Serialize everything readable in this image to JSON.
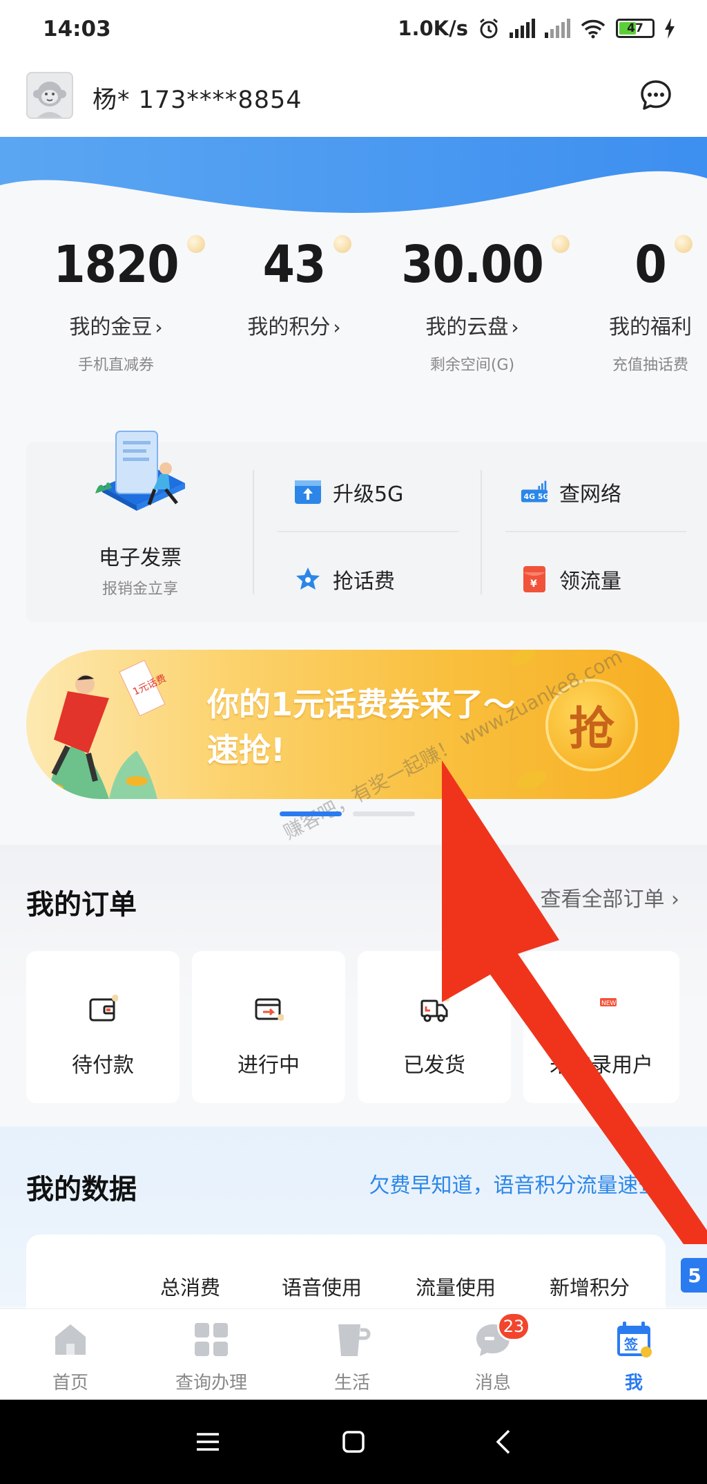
{
  "status_bar": {
    "time": "14:03",
    "network_speed": "1.0K/s",
    "battery": "47"
  },
  "header": {
    "user": "杨* 173****8854",
    "icons": [
      "avatar",
      "message-icon"
    ]
  },
  "stats": [
    {
      "value": "1820",
      "label": "我的金豆",
      "sub": "手机直减券"
    },
    {
      "value": "43",
      "label": "我的积分",
      "sub": ""
    },
    {
      "value": "30.00",
      "label": "我的云盘",
      "sub": "剩余空间(G)"
    },
    {
      "value": "0",
      "label": "我的福利",
      "sub": "充值抽话费"
    }
  ],
  "services": {
    "invoice_title": "电子发票",
    "invoice_sub": "报销金立享",
    "items": [
      "升级5G",
      "查网络",
      "抢话费",
      "领流量"
    ]
  },
  "banner": {
    "line1": "你的1元话费券来了～",
    "line2": "速抢!",
    "button": "抢",
    "tag": "1元话费",
    "watermark": "赚客吧，有奖一起赚！ www.zuanke8.com"
  },
  "orders": {
    "title": "我的订单",
    "link": "查看全部订单",
    "items": [
      "待付款",
      "进行中",
      "已发货",
      "未登录用户"
    ]
  },
  "data_section": {
    "title": "我的数据",
    "link": "欠费早知道，语音积分流量速查",
    "columns": [
      "总消费",
      "语音使用",
      "流量使用",
      "新增积分"
    ],
    "side_tab": "5"
  },
  "bottom_nav": {
    "items": [
      "首页",
      "查询办理",
      "生活",
      "消息",
      "我"
    ],
    "active_index": 4,
    "badge": "23"
  },
  "colors": {
    "accent": "#2b7bf0",
    "banner_orange": "#f9bf3d",
    "badge_red": "#f2452d",
    "arrow_red": "#f0341c"
  }
}
